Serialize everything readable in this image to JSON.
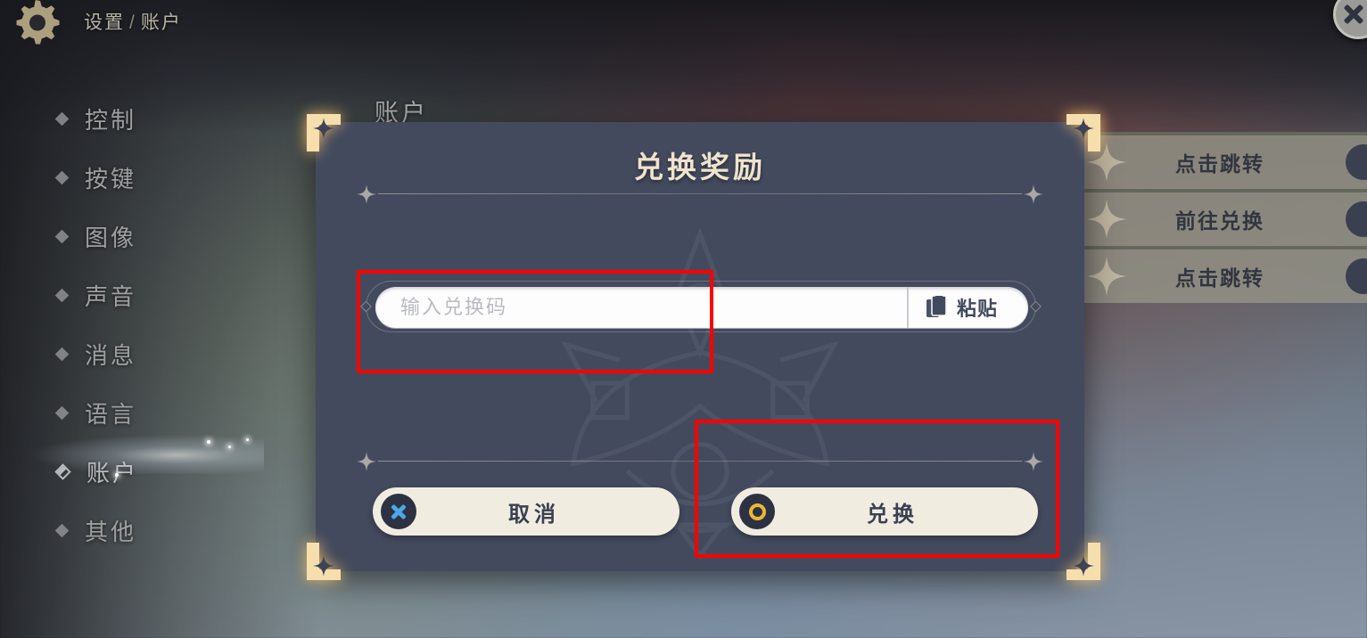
{
  "header": {
    "gear_icon": "gear-icon",
    "breadcrumb_root": "设置",
    "breadcrumb_sep": "/",
    "breadcrumb_current": "账户",
    "close_icon": "close-icon"
  },
  "sidebar": {
    "items": [
      {
        "label": "控制",
        "selected": false
      },
      {
        "label": "按键",
        "selected": false
      },
      {
        "label": "图像",
        "selected": false
      },
      {
        "label": "声音",
        "selected": false
      },
      {
        "label": "消息",
        "selected": false
      },
      {
        "label": "语言",
        "selected": false
      },
      {
        "label": "账户",
        "selected": true
      },
      {
        "label": "其他",
        "selected": false
      }
    ]
  },
  "page": {
    "tab_label": "账户"
  },
  "background_list": {
    "rows": [
      {
        "action_label": "点击跳转"
      },
      {
        "action_label": "前往兑换"
      },
      {
        "action_label": "点击跳转"
      }
    ]
  },
  "modal": {
    "title": "兑换奖励",
    "input": {
      "value": "",
      "placeholder": "输入兑换码"
    },
    "paste_button": {
      "label": "粘贴",
      "icon": "clipboard-paste-icon"
    },
    "buttons": {
      "cancel": {
        "label": "取消",
        "icon": "x-circle-icon"
      },
      "confirm": {
        "label": "兑换",
        "icon": "o-circle-icon"
      }
    }
  },
  "colors": {
    "modal_bg": "#434a5e",
    "title_gold": "#eee3cd",
    "button_cream": "#f1ece0",
    "cancel_blue": "#4ea6e4",
    "confirm_gold": "#e9b92f",
    "annotation_red": "#ff0000",
    "corner_gold": "#f3d9a4"
  }
}
